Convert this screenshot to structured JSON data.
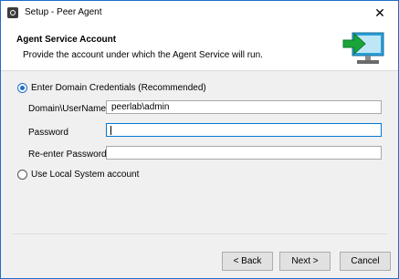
{
  "window": {
    "title": "Setup - Peer Agent",
    "close_glyph": "✕"
  },
  "header": {
    "title": "Agent Service Account",
    "subtitle": "Provide the account under which the Agent Service will run.",
    "image_icon": "computer-install-icon",
    "colors": {
      "arrow": "#1aa53a",
      "monitor": "#2aa0d8"
    }
  },
  "options": {
    "domain": {
      "label": "Enter Domain Credentials (Recommended)",
      "selected": true
    },
    "local": {
      "label": "Use Local System account",
      "selected": false
    }
  },
  "fields": {
    "username": {
      "label": "Domain\\UserName",
      "value": "peerlab\\admin"
    },
    "password": {
      "label": "Password",
      "value": ""
    },
    "reenter": {
      "label": "Re-enter Password",
      "value": ""
    }
  },
  "buttons": {
    "back": "< Back",
    "next": "Next >",
    "cancel": "Cancel"
  },
  "colors": {
    "accent": "#1e6fc9",
    "focus": "#0078d7"
  }
}
